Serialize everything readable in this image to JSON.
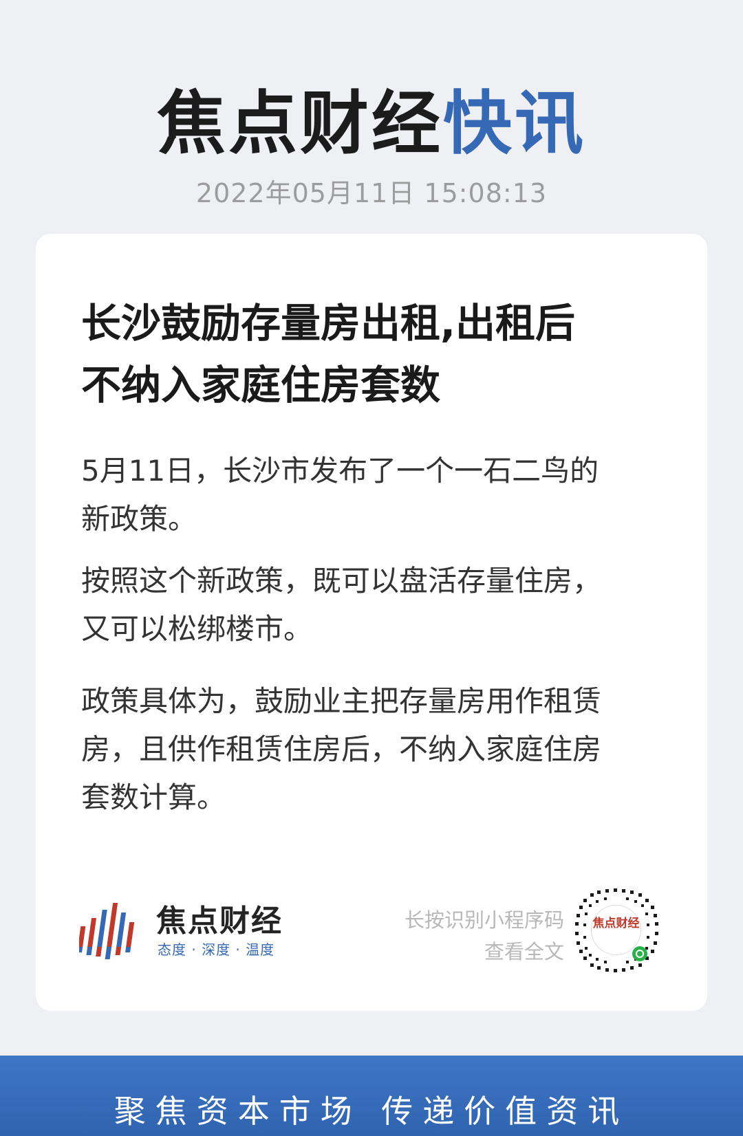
{
  "header": {
    "brand_dark": "焦点财经",
    "brand_blue": "快讯",
    "timestamp": "2022年05月11日 15:08:13"
  },
  "article": {
    "headline_line1": "长沙鼓励存量房出租,出租后",
    "headline_line2": "不纳入家庭住房套数",
    "paragraphs": [
      {
        "line1": "5月11日，长沙市发布了一个一石二鸟的",
        "line2": "新政策。"
      },
      {
        "line1": "按照这个新政策，既可以盘活存量住房，",
        "line2": "又可以松绑楼市。"
      },
      {
        "line1": "政策具体为，鼓励业主把存量房用作租赁",
        "line2": "房，且供作租赁住房后，不纳入家庭住房",
        "line3": "套数计算。"
      }
    ]
  },
  "footer": {
    "logo_name": "焦点财经",
    "logo_slogan": "态度 · 深度 · 温度",
    "qr_hint_line1": "长按识别小程序码",
    "qr_hint_line2": "查看全文",
    "qr_center_label": "焦点财经"
  },
  "banner": {
    "text": "聚焦资本市场 传递价值资讯"
  },
  "colors": {
    "brand_blue": "#3568b5",
    "logo_red": "#c0392b",
    "banner_blue": "#3568b5"
  },
  "icons": {
    "logo": "bar-logo-icon",
    "qr": "qr-code-icon"
  }
}
